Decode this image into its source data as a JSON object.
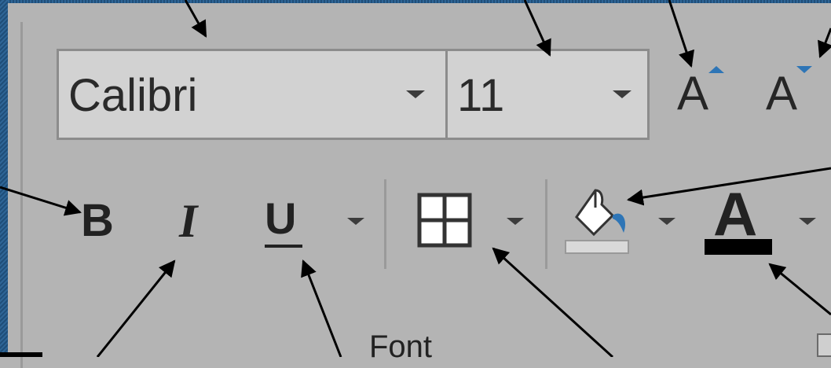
{
  "ribbon": {
    "font_name": {
      "value": "Calibri"
    },
    "font_size": {
      "value": "11"
    },
    "increase_font_label": "A",
    "decrease_font_label": "A",
    "bold_label": "B",
    "italic_label": "I",
    "underline_label": "U",
    "font_color_label": "A",
    "group_label": "Font"
  },
  "colors": {
    "ribbon_background": "#b4b4b4",
    "combo_background": "#d2d2d2",
    "accent_blue": "#2e75b6",
    "font_color_bar": "#000000",
    "fill_color_bar": "#d9d9d9"
  },
  "icons": [
    "font-size-increase-icon",
    "font-size-decrease-icon",
    "bold-icon",
    "italic-icon",
    "underline-icon",
    "borders-icon",
    "fill-color-bucket-icon",
    "font-color-icon",
    "dropdown-caret-icon",
    "dialog-launcher-icon",
    "callout-arrow"
  ]
}
